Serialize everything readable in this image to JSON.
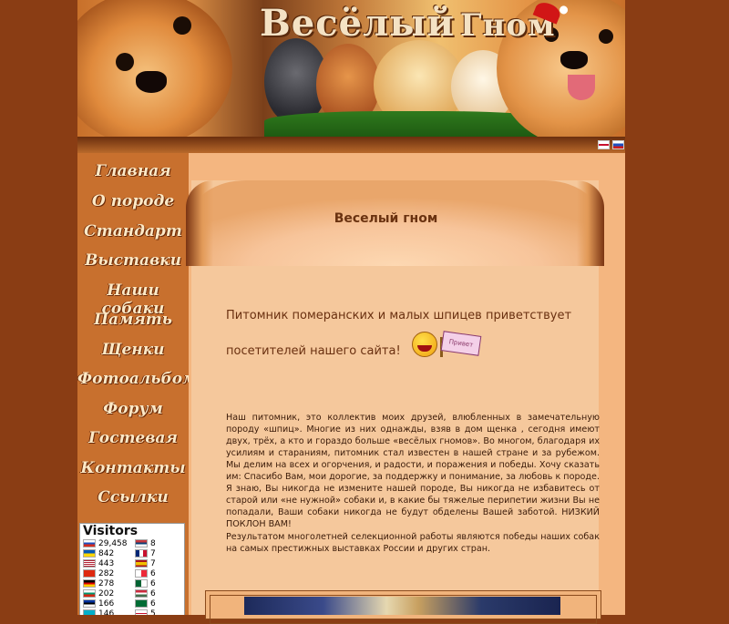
{
  "header": {
    "logo_title": "Весёлый",
    "logo_subtitle": "Гном"
  },
  "languages": [
    {
      "name": "English",
      "icon": "flag-uk-icon"
    },
    {
      "name": "Русский",
      "icon": "flag-ru-icon"
    }
  ],
  "menu": [
    "Главная",
    "О породе",
    "Стандарт",
    "Выставки",
    "Наши собаки",
    "Память",
    "Щенки",
    "Фотоальбом",
    "Форум",
    "Гостевая",
    "Контакты",
    "Ссылки"
  ],
  "visitors": {
    "title": "Visitors",
    "left": [
      {
        "count": "29,458",
        "flag": "#d52b1e"
      },
      {
        "count": "842",
        "flag": "#0057b7"
      },
      {
        "count": "443",
        "flag": "#3c3b6e"
      },
      {
        "count": "282",
        "flag": "#de2910"
      },
      {
        "count": "278",
        "flag": "#000000"
      },
      {
        "count": "202",
        "flag": "#00966e"
      },
      {
        "count": "166",
        "flag": "#0033a0"
      },
      {
        "count": "146",
        "flag": "#00afca"
      }
    ],
    "right": [
      {
        "count": "8",
        "flag": "#c6363c"
      },
      {
        "count": "7",
        "flag": "#c8102e"
      },
      {
        "count": "7",
        "flag": "#f1bf00"
      },
      {
        "count": "6",
        "flag": "#ed2939"
      },
      {
        "count": "6",
        "flag": "#006233"
      },
      {
        "count": "6",
        "flag": "#cd2a3e"
      },
      {
        "count": "6",
        "flag": "#006c35"
      },
      {
        "count": "5",
        "flag": "#ffffff"
      }
    ]
  },
  "content": {
    "page_title": "Веселый гном",
    "welcome_line1": "Питомник померанских и малых шпицев приветствует",
    "welcome_line2": "посетителей нашего сайта!",
    "sign_text": "Привет",
    "paragraph1": "Наш питомник, это коллектив моих друзей, влюбленных в замечательную породу «шпиц». Многие из них однажды, взяв в дом щенка , сегодня имеют двух, трёх, а кто и гораздо больше «весёлых гномов». Во многом, благодаря их усилиям и стараниям, питомник стал известен в нашей стране и за рубежом. Мы делим на всех и огорчения, и радости, и поражения и победы. Хочу сказать им: Спасибо Вам, мои дорогие, за поддержку и понимание, за любовь к породе. Я знаю, Вы никогда не измените нашей породе, Вы никогда не избавитесь от старой или «не нужной» собаки и, в какие бы тяжелые перипетии жизни Вы не попадали, Ваши собаки никогда не будут обделены Вашей заботой. НИЗКИЙ ПОКЛОН ВАМ!",
    "paragraph2": "Результатом многолетней селекционной работы являются победы наших собак на самых престижных выставках России и других стран."
  }
}
